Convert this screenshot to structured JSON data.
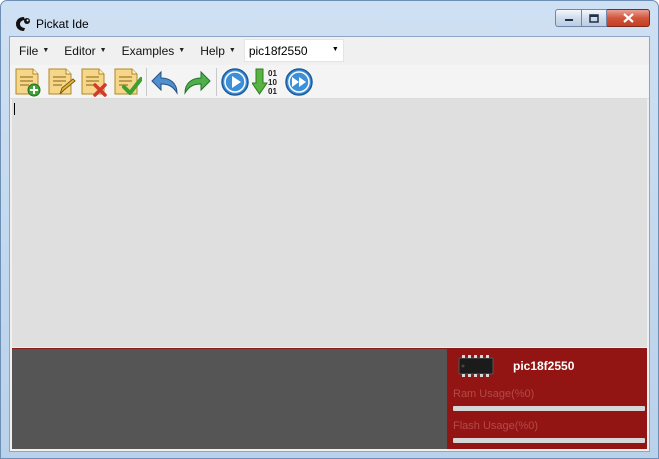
{
  "window": {
    "title": "Pickat Ide",
    "buttons": {
      "minimize": "minimize",
      "maximize": "maximize",
      "close": "close"
    }
  },
  "menubar": {
    "items": [
      {
        "label": "File"
      },
      {
        "label": "Editor"
      },
      {
        "label": "Examples"
      },
      {
        "label": "Help"
      }
    ],
    "device_select": {
      "value": "pic18f2550"
    }
  },
  "toolbar": {
    "buttons": [
      {
        "icon": "new-file-icon"
      },
      {
        "icon": "edit-file-icon"
      },
      {
        "icon": "delete-file-icon"
      },
      {
        "icon": "check-file-icon"
      },
      {
        "icon": "undo-icon"
      },
      {
        "icon": "redo-icon"
      },
      {
        "icon": "run-icon"
      },
      {
        "icon": "download-binary-icon"
      },
      {
        "icon": "fast-forward-icon"
      }
    ]
  },
  "editor": {
    "content": ""
  },
  "device_panel": {
    "name": "pic18f2550",
    "ram_label": "Ram Usage(%0)",
    "ram_usage": 0,
    "flash_label": "Flash Usage(%0)",
    "flash_usage": 0,
    "accent": "#921514"
  }
}
